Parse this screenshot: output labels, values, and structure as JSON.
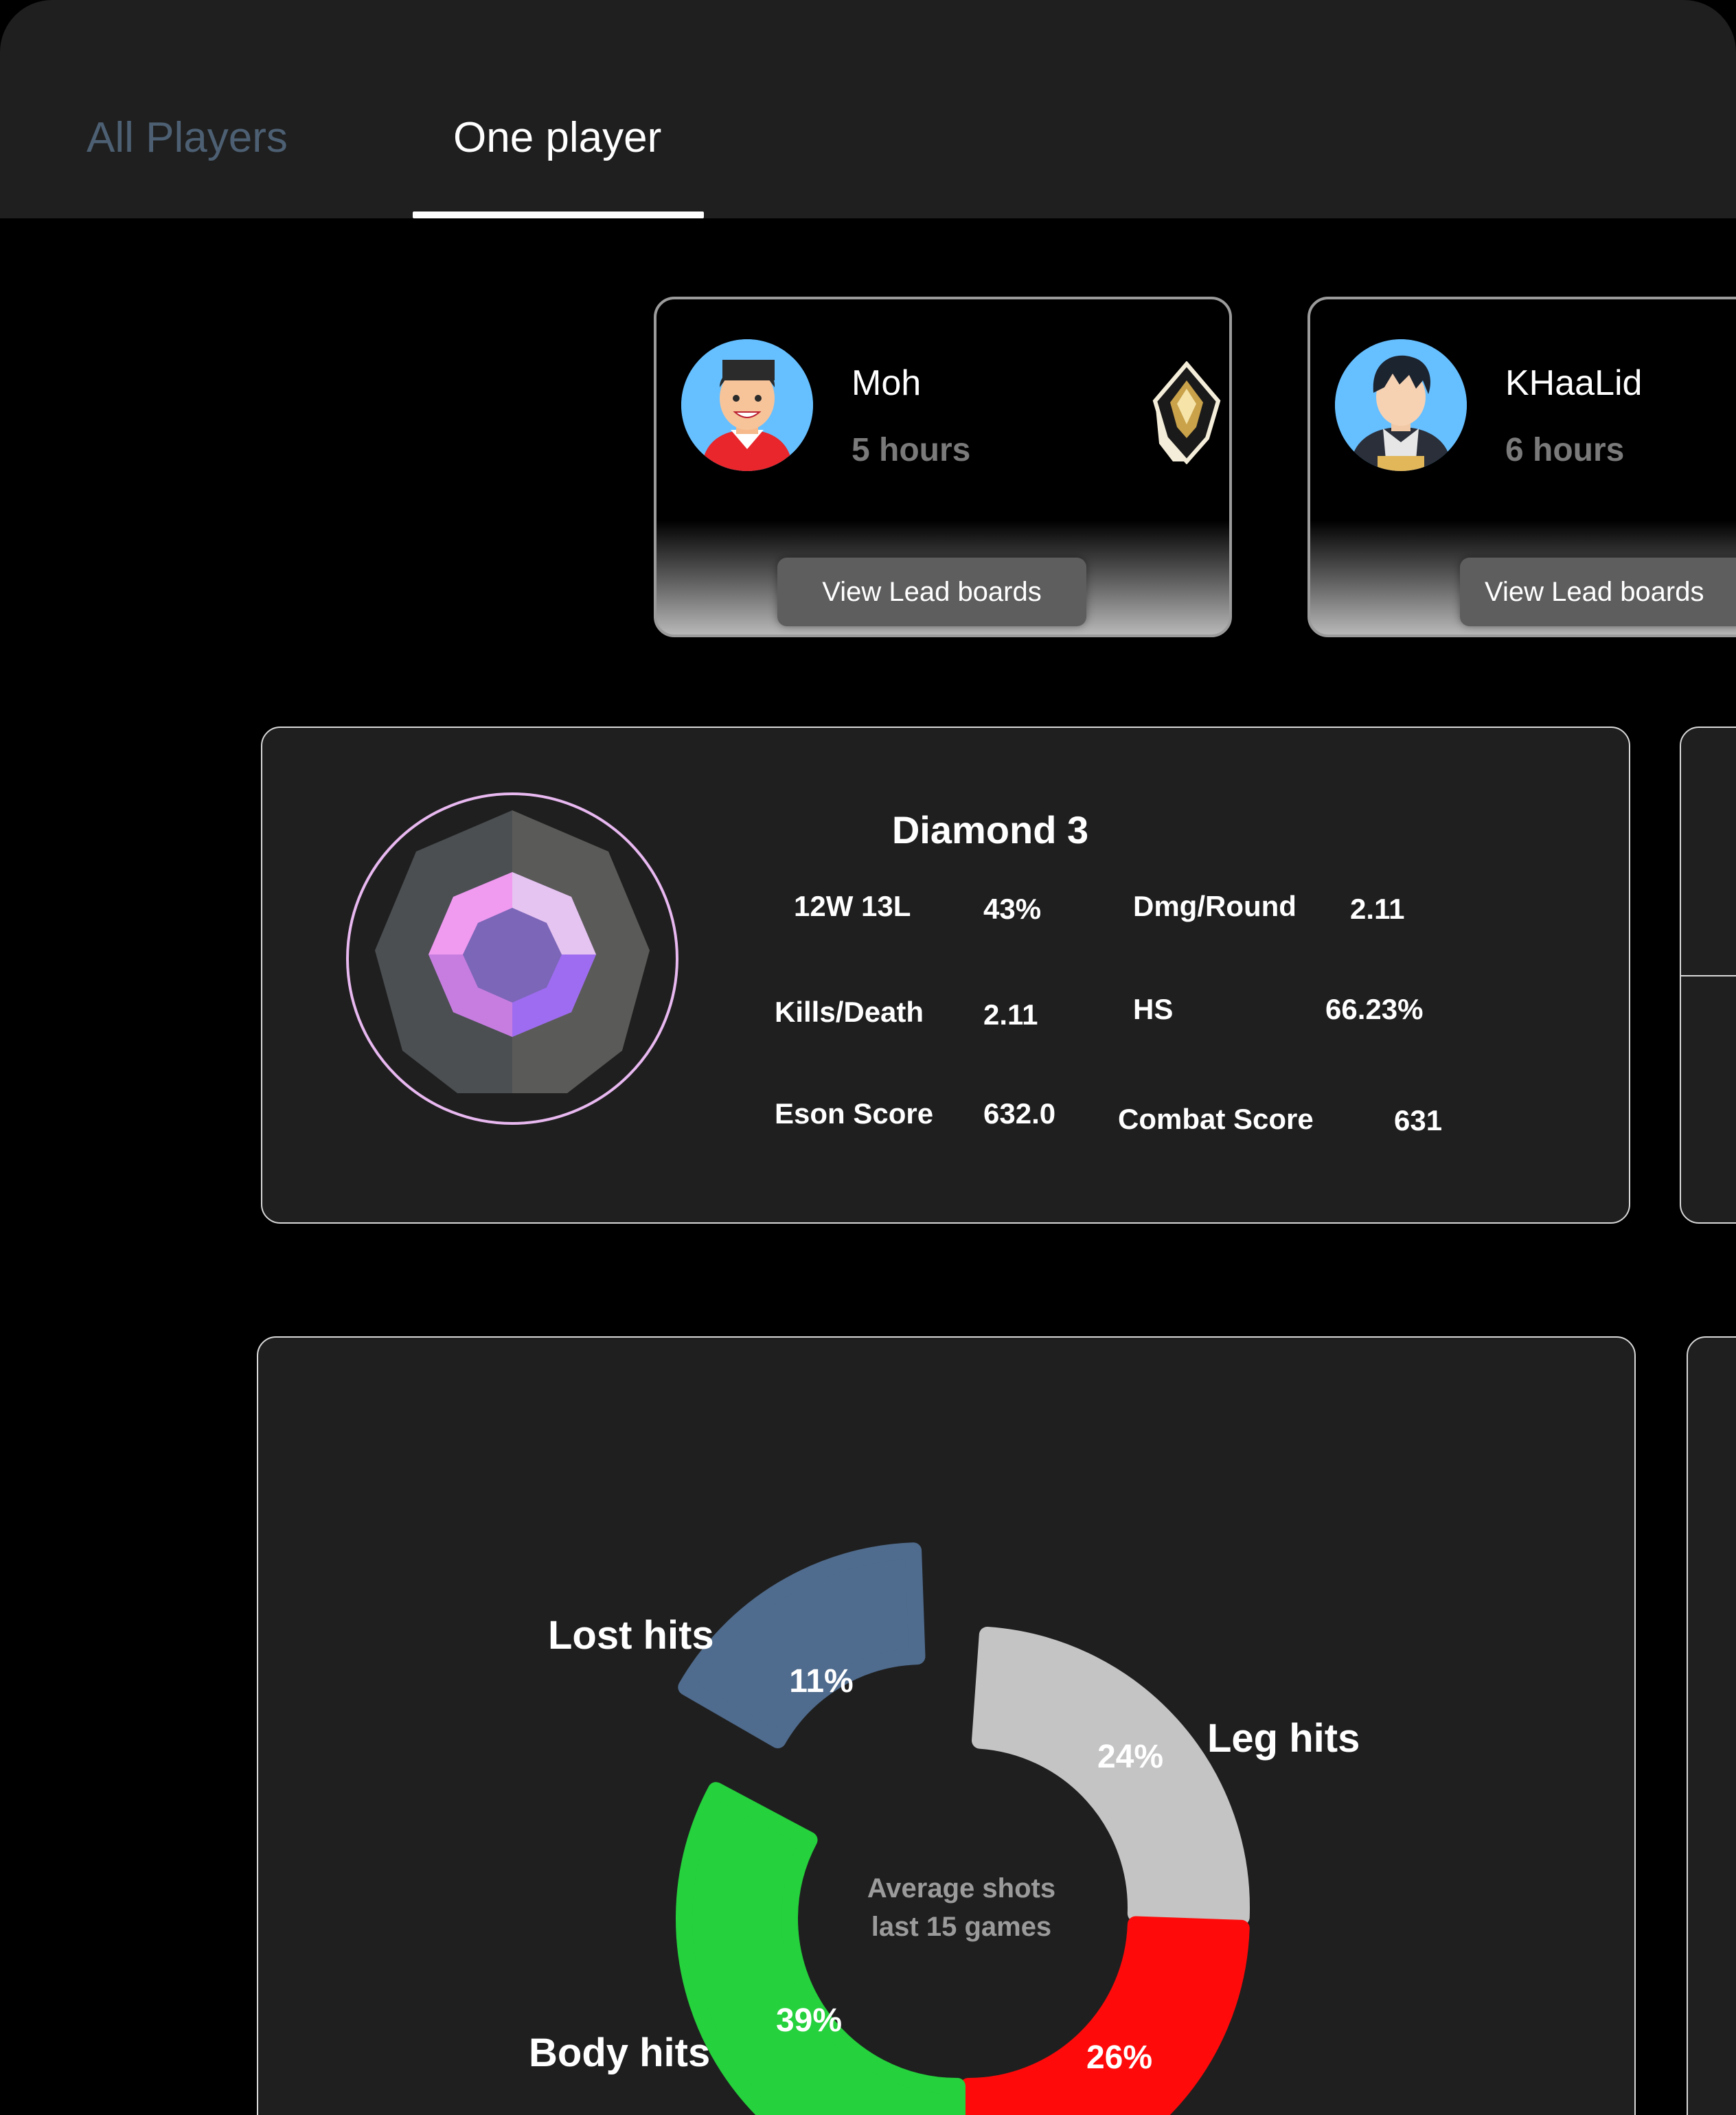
{
  "tabs": {
    "all_players": "All Players",
    "one_player": "One player"
  },
  "players": [
    {
      "name": "Moh",
      "hours": "5 hours",
      "button": "View Lead boards"
    },
    {
      "name": "KHaaLid",
      "hours": "6 hours",
      "button": "View Lead boards"
    }
  ],
  "rank": {
    "title": "Diamond 3",
    "record": "12W 13L",
    "win_rate": "43%",
    "dmg_label": "Dmg/Round",
    "dmg_value": "2.11",
    "kd_label": "Kills/Death",
    "kd_value": "2.11",
    "hs_label": "HS",
    "hs_value": "66.23%",
    "eson_label": "Eson Score",
    "eson_value": "632.0",
    "combat_label": "Combat Score",
    "combat_value": "631"
  },
  "chart_data": {
    "type": "pie",
    "center_label": [
      "Average shots",
      "last 15 games"
    ],
    "series": [
      {
        "label": "Lost hits",
        "value": 11,
        "value_label": "11%",
        "color": "#4f6b8d"
      },
      {
        "label": "Leg hits",
        "value": 24,
        "value_label": "24%",
        "color": "#c4c4c4"
      },
      {
        "label": "",
        "value": 26,
        "value_label": "26%",
        "color": "#ff0a0a"
      },
      {
        "label": "Body hits",
        "value": 39,
        "value_label": "39%",
        "color": "#25d13c"
      }
    ]
  },
  "colors": {
    "accent": "#ffffff",
    "muted_tab": "#4d6073",
    "panel": "#1f1f1f"
  }
}
